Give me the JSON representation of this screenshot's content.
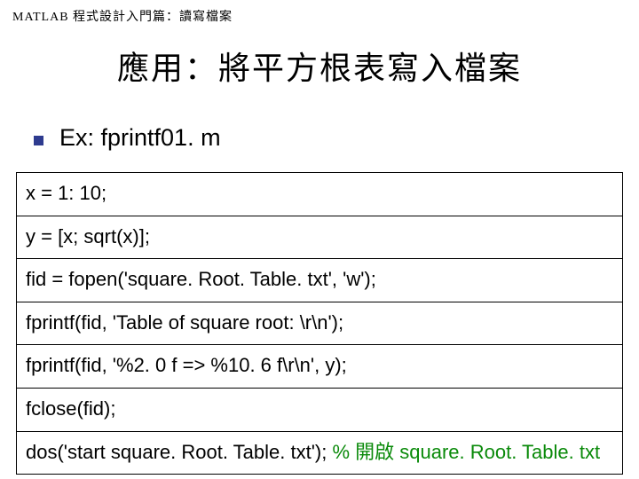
{
  "header": "MATLAB 程式設計入門篇：讀寫檔案",
  "title": "應用：將平方根表寫入檔案",
  "subtitle": "Ex: fprintf01. m",
  "code": {
    "lines": [
      {
        "text": "x = 1: 10;"
      },
      {
        "text": "y = [x; sqrt(x)];"
      },
      {
        "text": "fid = fopen('square. Root. Table. txt', 'w');"
      },
      {
        "text": "fprintf(fid, 'Table of square root: \\r\\n');"
      },
      {
        "text": "fprintf(fid, '%2. 0 f => %10. 6 f\\r\\n', y);"
      },
      {
        "text": "fclose(fid);"
      },
      {
        "text": "dos('start square. Root. Table. txt');  ",
        "comment": "% 開啟 square. Root. Table. txt"
      }
    ]
  }
}
